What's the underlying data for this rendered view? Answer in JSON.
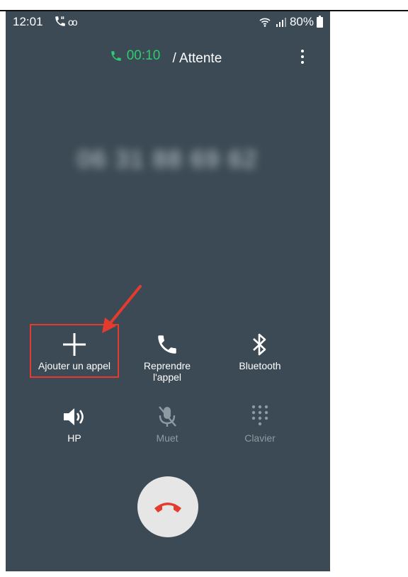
{
  "status_bar": {
    "time": "12:01",
    "battery": "80%",
    "voicemail_symbol": "oo",
    "icons": [
      "wifi-calling-icon",
      "signal-icon",
      "battery-icon",
      "call-icon",
      "voicemail-icon"
    ]
  },
  "call": {
    "timer": "00:10",
    "status": "/ Attente",
    "number": "06 31 88 69 62"
  },
  "actions": [
    {
      "label": "Ajouter un appel",
      "icon": "plus-icon",
      "enabled": true
    },
    {
      "label_line1": "Reprendre",
      "label_line2": "l'appel",
      "icon": "phone-icon",
      "enabled": true
    },
    {
      "label": "Bluetooth",
      "icon": "bluetooth-icon",
      "enabled": true
    },
    {
      "label": "HP",
      "icon": "speaker-icon",
      "enabled": true
    },
    {
      "label": "Muet",
      "icon": "mute-icon",
      "enabled": false
    },
    {
      "label": "Clavier",
      "icon": "keypad-icon",
      "enabled": false
    }
  ],
  "colors": {
    "background": "#3b4a54",
    "timer_green": "#2ecc71",
    "annotation_red": "#e53b2f",
    "end_call_red": "#e53b2f",
    "disabled_gray": "#8e9aa1"
  }
}
